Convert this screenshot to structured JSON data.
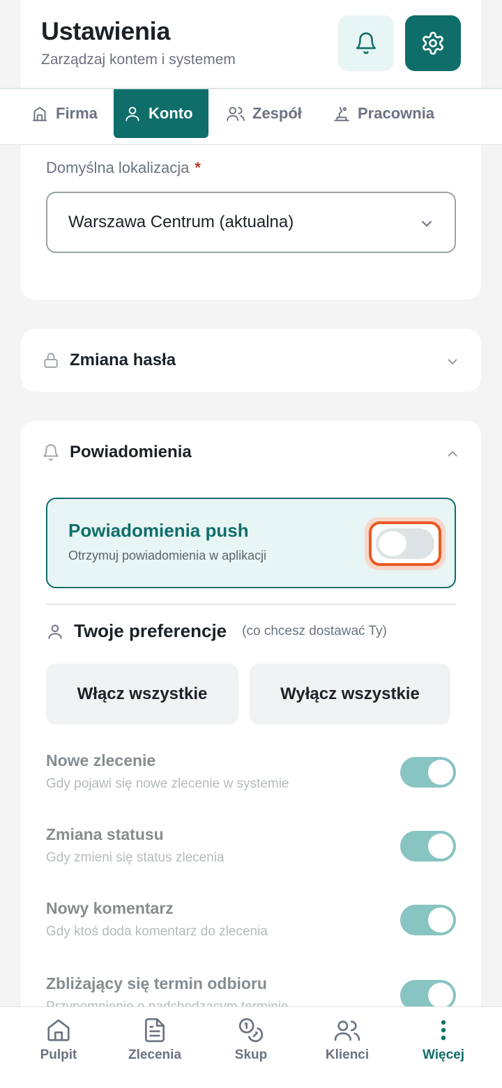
{
  "header": {
    "title": "Ustawienia",
    "subtitle": "Zarządzaj kontem i systemem",
    "bell_icon": "bell-icon",
    "gear_icon": "gear-icon",
    "accent_color": "#0f6e6a"
  },
  "tabs": [
    {
      "label": "Firma",
      "icon": "building-icon",
      "active": false
    },
    {
      "label": "Konto",
      "icon": "user-icon",
      "active": true
    },
    {
      "label": "Zespół",
      "icon": "users-icon",
      "active": false
    },
    {
      "label": "Pracownia",
      "icon": "workshop-icon",
      "active": false
    }
  ],
  "location": {
    "label": "Domyślna lokalizacja",
    "required_mark": "*",
    "value": "Warszawa Centrum (aktualna)"
  },
  "password_section": {
    "title": "Zmiana hasła",
    "expanded": false
  },
  "notifications_section": {
    "title": "Powiadomienia",
    "expanded": true,
    "push": {
      "title": "Powiadomienia push",
      "subtitle": "Otrzymuj powiadomienia w aplikacji",
      "enabled": false
    },
    "preferences": {
      "title": "Twoje preferencje",
      "note": "(co chcesz dostawać Ty)",
      "enable_all": "Włącz wszystkie",
      "disable_all": "Wyłącz wszystkie",
      "items": [
        {
          "title": "Nowe zlecenie",
          "subtitle": "Gdy pojawi się nowe zlecenie w systemie",
          "enabled": true
        },
        {
          "title": "Zmiana statusu",
          "subtitle": "Gdy zmieni się status zlecenia",
          "enabled": true
        },
        {
          "title": "Nowy komentarz",
          "subtitle": "Gdy ktoś doda komentarz do zlecenia",
          "enabled": true
        },
        {
          "title": "Zbliżający się termin odbioru",
          "subtitle": "Przypomnienie o nadchodzącym terminie",
          "enabled": true
        }
      ]
    }
  },
  "bottom_nav": [
    {
      "label": "Pulpit",
      "icon": "home-icon",
      "active": false
    },
    {
      "label": "Zlecenia",
      "icon": "document-icon",
      "active": false
    },
    {
      "label": "Skup",
      "icon": "coins-icon",
      "active": false
    },
    {
      "label": "Klienci",
      "icon": "users-icon",
      "active": false
    },
    {
      "label": "Więcej",
      "icon": "more-vertical-icon",
      "active": true
    }
  ]
}
